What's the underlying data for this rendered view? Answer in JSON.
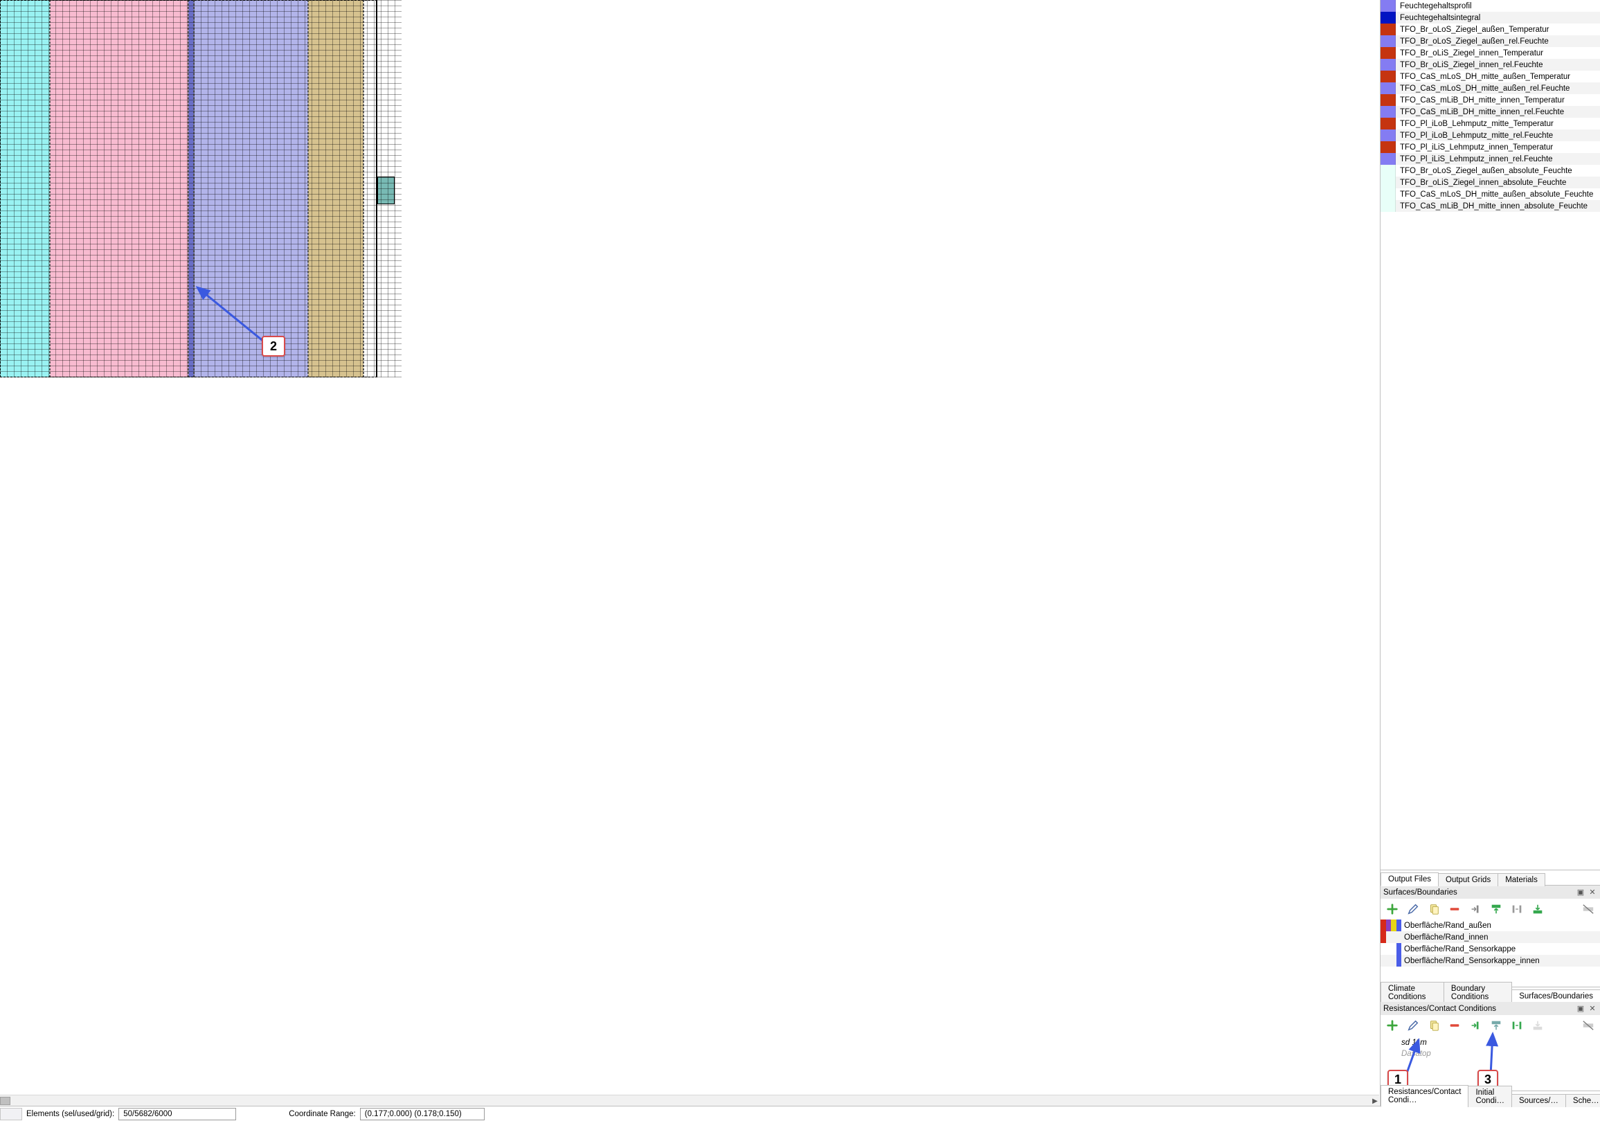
{
  "statusbar": {
    "elements_label": "Elements (sel/used/grid):",
    "elements_value": "50/5682/6000",
    "coord_label": "Coordinate Range:",
    "coord_value": "(0.177;0.000)  (0.178;0.150)"
  },
  "outputs": {
    "items": [
      {
        "color": "swatch-lav",
        "label": "Feuchtegehaltsprofil"
      },
      {
        "color": "swatch-blue",
        "label": "Feuchtegehaltsintegral"
      },
      {
        "color": "swatch-rust",
        "label": "TFO_Br_oLoS_Ziegel_außen_Temperatur"
      },
      {
        "color": "swatch-lav",
        "label": "TFO_Br_oLoS_Ziegel_außen_rel.Feuchte"
      },
      {
        "color": "swatch-rust",
        "label": "TFO_Br_oLiS_Ziegel_innen_Temperatur"
      },
      {
        "color": "swatch-lav",
        "label": "TFO_Br_oLiS_Ziegel_innen_rel.Feuchte"
      },
      {
        "color": "swatch-rust",
        "label": "TFO_CaS_mLoS_DH_mitte_außen_Temperatur"
      },
      {
        "color": "swatch-lav",
        "label": "TFO_CaS_mLoS_DH_mitte_außen_rel.Feuchte"
      },
      {
        "color": "swatch-rust",
        "label": "TFO_CaS_mLiB_DH_mitte_innen_Temperatur"
      },
      {
        "color": "swatch-lav",
        "label": "TFO_CaS_mLiB_DH_mitte_innen_rel.Feuchte"
      },
      {
        "color": "swatch-rust",
        "label": "TFO_Pl_iLoB_Lehmputz_mitte_Temperatur"
      },
      {
        "color": "swatch-lav",
        "label": "TFO_Pl_iLoB_Lehmputz_mitte_rel.Feuchte"
      },
      {
        "color": "swatch-rust",
        "label": "TFO_Pl_iLiS_Lehmputz_innen_Temperatur"
      },
      {
        "color": "swatch-lav",
        "label": "TFO_Pl_iLiS_Lehmputz_innen_rel.Feuchte"
      },
      {
        "color": "swatch-pale",
        "label": "TFO_Br_oLoS_Ziegel_außen_absolute_Feuchte"
      },
      {
        "color": "swatch-pale",
        "label": "TFO_Br_oLiS_Ziegel_innen_absolute_Feuchte"
      },
      {
        "color": "swatch-pale",
        "label": "TFO_CaS_mLoS_DH_mitte_außen_absolute_Feuchte"
      },
      {
        "color": "swatch-pale",
        "label": "TFO_CaS_mLiB_DH_mitte_innen_absolute_Feuchte"
      }
    ],
    "tabs": {
      "files": "Output Files",
      "grids": "Output Grids",
      "materials": "Materials"
    }
  },
  "surfaces": {
    "title": "Surfaces/Boundaries",
    "items": [
      {
        "sw": [
          "ss-red",
          "ss-pur",
          "ss-yel",
          "ss-blu"
        ],
        "label": "Oberfläche/Rand_außen"
      },
      {
        "sw": [
          "ss-red",
          "ss-none",
          "ss-none",
          "ss-none"
        ],
        "label": "Oberfläche/Rand_innen"
      },
      {
        "sw": [
          "ss-none",
          "ss-none",
          "ss-none",
          "ss-blu"
        ],
        "label": "Oberfläche/Rand_Sensorkappe"
      },
      {
        "sw": [
          "ss-none",
          "ss-none",
          "ss-none",
          "ss-blu"
        ],
        "label": "Oberfläche/Rand_Sensorkappe_innen"
      }
    ],
    "tabs": {
      "climate": "Climate Conditions",
      "boundary": "Boundary Conditions",
      "surfaces": "Surfaces/Boundaries"
    }
  },
  "resistances": {
    "title": "Resistances/Contact Conditions",
    "items": [
      {
        "label": "sd 11m",
        "selected": true
      },
      {
        "label": "Dasatop",
        "placeholder": true
      }
    ],
    "tabs": {
      "res": "Resistances/Contact Condi…",
      "init": "Initial Condi…",
      "src": "Sources/…",
      "sched": "Sche…"
    }
  },
  "annotations": {
    "a1": "1",
    "a2": "2",
    "a3": "3"
  }
}
